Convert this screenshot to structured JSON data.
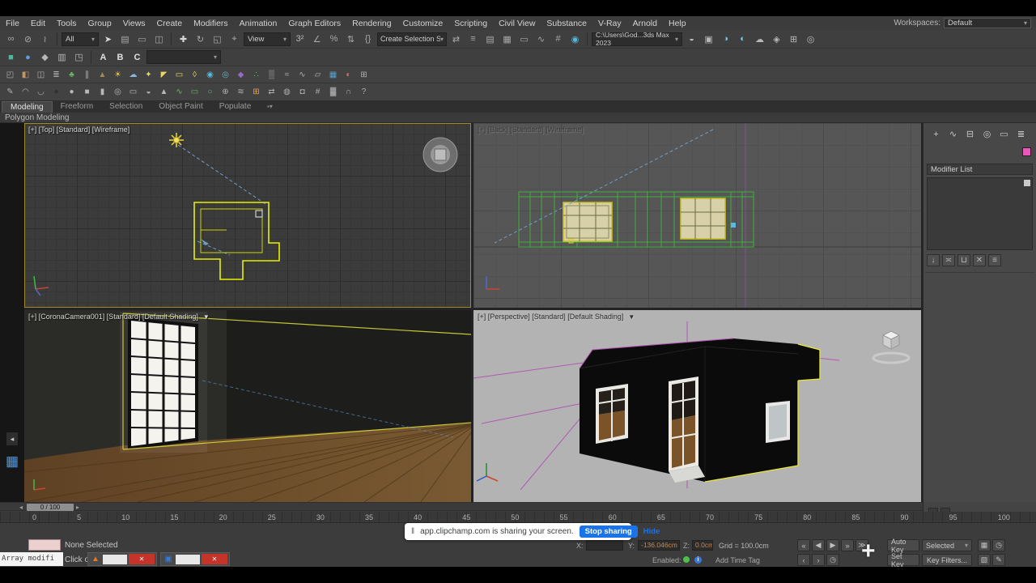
{
  "ui": {
    "caret": "▾",
    "funnel_icon": "▼",
    "close_icon": "✕",
    "plus_cursor": "+",
    "pause_bars": "‖",
    "info_i": "i",
    "slider_left_arrow": "◂",
    "slider_right_arrow": "▸"
  },
  "menu_bar": {
    "items": [
      "File",
      "Edit",
      "Tools",
      "Group",
      "Views",
      "Create",
      "Modifiers",
      "Animation",
      "Graph Editors",
      "Rendering",
      "Customize",
      "Scripting",
      "Civil View",
      "Substance",
      "V-Ray",
      "Arnold",
      "Help"
    ],
    "workspaces_label": "Workspaces:",
    "workspaces_value": "Default"
  },
  "toolbars": {
    "row1": {
      "seg_a": [
        {
          "n": "select-and-link-icon",
          "g": "∞",
          "c": "#a8a8a8"
        },
        {
          "n": "unlink-selection-icon",
          "g": "⊘",
          "c": "#a8a8a8"
        },
        {
          "n": "bind-to-space-warp-icon",
          "g": "≀",
          "c": "#a8a8a8"
        }
      ],
      "all_dropdown": "All",
      "seg_b": [
        {
          "n": "select-object-icon",
          "g": "➤",
          "c": "#d8d8d8"
        },
        {
          "n": "select-by-name-icon",
          "g": "▤",
          "c": "#a8a8a8"
        },
        {
          "n": "rectangular-selection-region-icon",
          "g": "▭",
          "c": "#a8a8a8"
        },
        {
          "n": "window-crossing-icon",
          "g": "◫",
          "c": "#a8a8a8"
        }
      ],
      "seg_c": [
        {
          "n": "select-and-move-icon",
          "g": "✚",
          "c": "#d8d8d8"
        },
        {
          "n": "select-and-rotate-icon",
          "g": "↻",
          "c": "#a8a8a8"
        },
        {
          "n": "select-and-scale-icon",
          "g": "◱",
          "c": "#a8a8a8"
        },
        {
          "n": "pivot-center-icon",
          "g": "⌖",
          "c": "#a8a8a8"
        }
      ],
      "view_dropdown": "View",
      "seg_d": [
        {
          "n": "snaps-toggle-icon",
          "g": "3²",
          "c": "#b8b8b8"
        },
        {
          "n": "angle-snap-icon",
          "g": "∠",
          "c": "#a8a8a8"
        },
        {
          "n": "percent-snap-icon",
          "g": "%",
          "c": "#a8a8a8"
        },
        {
          "n": "spinner-snap-icon",
          "g": "⇅",
          "c": "#a8a8a8"
        },
        {
          "n": "edit-named-selection-sets-icon",
          "g": "{}",
          "c": "#a8a8a8"
        }
      ],
      "selection_set_value": "Create Selection Se",
      "seg_e": [
        {
          "n": "mirror-icon",
          "g": "⇄",
          "c": "#a8a8a8"
        },
        {
          "n": "align-icon",
          "g": "≡",
          "c": "#a8a8a8"
        },
        {
          "n": "scene-explorer-icon",
          "g": "▤",
          "c": "#a8a8a8"
        },
        {
          "n": "layer-explorer-icon",
          "g": "▦",
          "c": "#a8a8a8"
        },
        {
          "n": "ribbon-toggle-icon",
          "g": "▭",
          "c": "#a8a8a8"
        },
        {
          "n": "curve-editor-icon",
          "g": "∿",
          "c": "#a8a8a8"
        },
        {
          "n": "schematic-view-icon",
          "g": "#",
          "c": "#a8a8a8"
        },
        {
          "n": "material-editor-icon",
          "g": "◉",
          "c": "#58b8d8"
        }
      ],
      "project_path": "C:\\Users\\God...3ds Max 2023",
      "seg_f": [
        {
          "n": "render-setup-icon",
          "g": "◒",
          "c": "#b8b8b8"
        },
        {
          "n": "rendered-frame-window-icon",
          "g": "▣",
          "c": "#b8b8b8"
        },
        {
          "n": "render-production-icon",
          "g": "◑",
          "c": "#78c8e8"
        },
        {
          "n": "render-iterative-icon",
          "g": "◐",
          "c": "#78c8e8"
        },
        {
          "n": "render-in-cloud-icon",
          "g": "☁",
          "c": "#b8b8b8"
        },
        {
          "n": "asset-library-icon",
          "g": "◈",
          "c": "#b8b8b8"
        },
        {
          "n": "data-channel-icon",
          "g": "⊞",
          "c": "#b8b8b8"
        },
        {
          "n": "arnold-light-icon",
          "g": "◎",
          "c": "#b8b8b8"
        }
      ]
    },
    "row2": {
      "icons_left": [
        {
          "n": "slate-material-editor-icon",
          "g": "■",
          "c": "#3fbf9f"
        },
        {
          "n": "compact-material-editor-icon",
          "g": "●",
          "c": "#5aa0e0"
        },
        {
          "n": "snapshot-icon",
          "g": "◆",
          "c": "#b8b8b8"
        },
        {
          "n": "layers-icon",
          "g": "▥",
          "c": "#b8b8b8"
        },
        {
          "n": "containers-icon",
          "g": "◳",
          "c": "#b8b8b8"
        }
      ],
      "letters": [
        {
          "n": "letter-a-icon",
          "g": "A",
          "c": "#e0e0e0"
        },
        {
          "n": "letter-b-icon",
          "g": "B",
          "c": "#e0e0e0"
        },
        {
          "n": "letter-c-icon",
          "g": "C",
          "c": "#e0e0e0"
        }
      ],
      "preset_dropdown_value": ""
    },
    "row3": {
      "icons": [
        {
          "n": "wall-tool-icon",
          "g": "◰",
          "c": "#b0b0b0"
        },
        {
          "n": "door-tool-icon",
          "g": "◧",
          "c": "#c09868"
        },
        {
          "n": "window-tool-icon",
          "g": "◫",
          "c": "#b0b0b0"
        },
        {
          "n": "stairs-tool-icon",
          "g": "≣",
          "c": "#b0b0b0"
        },
        {
          "n": "foliage-icon",
          "g": "♣",
          "c": "#68b868"
        },
        {
          "n": "railing-icon",
          "g": "∥",
          "c": "#b0b0b0"
        },
        {
          "n": "terrain-icon",
          "g": "▲",
          "c": "#a08858"
        },
        {
          "n": "sun-light-icon",
          "g": "☀",
          "c": "#e8c840"
        },
        {
          "n": "sky-light-icon",
          "g": "☁",
          "c": "#88b8e0"
        },
        {
          "n": "omni-light-icon",
          "g": "✦",
          "c": "#e8d860"
        },
        {
          "n": "spot-light-icon",
          "g": "◤",
          "c": "#e8d860"
        },
        {
          "n": "area-light-icon",
          "g": "▭",
          "c": "#e8d860"
        },
        {
          "n": "photometric-light-icon",
          "g": "◊",
          "c": "#e8d860"
        },
        {
          "n": "physical-camera-icon",
          "g": "◉",
          "c": "#58b8d8"
        },
        {
          "n": "target-camera-icon",
          "g": "◎",
          "c": "#58b8d8"
        },
        {
          "n": "proxy-object-icon",
          "g": "◆",
          "c": "#9868c8"
        },
        {
          "n": "scatter-tool-icon",
          "g": "∴",
          "c": "#68b868"
        },
        {
          "n": "volume-helper-icon",
          "g": "▒",
          "c": "#b0b0b0"
        },
        {
          "n": "displace-modifier-icon",
          "g": "≈",
          "c": "#b0b0b0"
        },
        {
          "n": "hair-fur-icon",
          "g": "∿",
          "c": "#b0b0b0"
        },
        {
          "n": "cloth-modifier-icon",
          "g": "▱",
          "c": "#b0b0b0"
        },
        {
          "n": "bitmap-map-icon",
          "g": "▦",
          "c": "#58a0d0"
        },
        {
          "n": "color-correction-icon",
          "g": "◐",
          "c": "#d87858"
        },
        {
          "n": "uvw-map-icon",
          "g": "⊞",
          "c": "#b0b0b0"
        }
      ]
    },
    "row4": {
      "icons": [
        {
          "n": "paint-deform-icon",
          "g": "✎",
          "c": "#b0b0b0"
        },
        {
          "n": "conform-brush-icon",
          "g": "◠",
          "c": "#b0b0b0"
        },
        {
          "n": "relax-brush-icon",
          "g": "◡",
          "c": "#b0b0b0"
        },
        {
          "n": "pool-ball-icon",
          "g": "●",
          "c": "#303030"
        },
        {
          "n": "sphere-primitive-icon",
          "g": "●",
          "c": "#b8b8b8"
        },
        {
          "n": "box-primitive-icon",
          "g": "■",
          "c": "#b8b8b8"
        },
        {
          "n": "cylinder-primitive-icon",
          "g": "▮",
          "c": "#b8b8b8"
        },
        {
          "n": "torus-primitive-icon",
          "g": "◎",
          "c": "#b8b8b8"
        },
        {
          "n": "plane-primitive-icon",
          "g": "▭",
          "c": "#b8b8b8"
        },
        {
          "n": "teapot-primitive-icon",
          "g": "◒",
          "c": "#b8b8b8"
        },
        {
          "n": "cone-primitive-icon",
          "g": "▲",
          "c": "#b8b8b8"
        },
        {
          "n": "spline-tool-icon",
          "g": "∿",
          "c": "#68b868"
        },
        {
          "n": "rectangle-spline-icon",
          "g": "▭",
          "c": "#68b868"
        },
        {
          "n": "circle-spline-icon",
          "g": "○",
          "c": "#68b868"
        },
        {
          "n": "boolean-tool-icon",
          "g": "⊕",
          "c": "#b0b0b0"
        },
        {
          "n": "loft-tool-icon",
          "g": "≋",
          "c": "#b0b0b0"
        },
        {
          "n": "ffd-modifier-icon",
          "g": "⊞",
          "c": "#e8a048"
        },
        {
          "n": "symmetry-modifier-icon",
          "g": "⇄",
          "c": "#b0b0b0"
        },
        {
          "n": "turbosmooth-icon",
          "g": "◍",
          "c": "#b0b0b0"
        },
        {
          "n": "shell-modifier-icon",
          "g": "◘",
          "c": "#b0b0b0"
        },
        {
          "n": "lattice-modifier-icon",
          "g": "#",
          "c": "#b0b0b0"
        },
        {
          "n": "noise-modifier-icon",
          "g": "▓",
          "c": "#b0b0b0"
        },
        {
          "n": "bend-modifier-icon",
          "g": "∩",
          "c": "#b0b0b0"
        },
        {
          "n": "help-icon",
          "g": "?",
          "c": "#b0b0b0"
        }
      ]
    }
  },
  "ribbon": {
    "tabs": [
      "Modeling",
      "Freeform",
      "Selection",
      "Object Paint",
      "Populate"
    ],
    "active_tab": "Modeling",
    "panel_label": "Polygon Modeling"
  },
  "left_strip": {
    "icons": [
      {
        "n": "collapse-panel-icon",
        "g": "◂",
        "c": "#c8c8c8"
      },
      {
        "n": "massfx-toolbar-icon",
        "g": "▦",
        "c": "#5898d8"
      }
    ]
  },
  "viewports": {
    "top_left": {
      "label": "[+] [Top] [Standard] [Wireframe]"
    },
    "top_right": {
      "label": "[+] [Back] [Standard] [Wireframe]"
    },
    "bottom_left": {
      "label": "[+] [CoronaCamera001] [Standard] [Default Shading]"
    },
    "bottom_right": {
      "label": "[+] [Perspective] [Standard] [Default Shading]"
    }
  },
  "command_panel": {
    "tab_icons": [
      {
        "n": "create-tab-icon",
        "g": "+",
        "c": "#c8c8c8"
      },
      {
        "n": "modify-tab-icon",
        "g": "∿",
        "c": "#c8c8c8"
      },
      {
        "n": "hierarchy-tab-icon",
        "g": "⊟",
        "c": "#c8c8c8"
      },
      {
        "n": "motion-tab-icon",
        "g": "◎",
        "c": "#c8c8c8"
      },
      {
        "n": "display-tab-icon",
        "g": "▭",
        "c": "#c8c8c8"
      },
      {
        "n": "utilities-tab-icon",
        "g": "≣",
        "c": "#c8c8c8"
      }
    ],
    "modifier_list_label": "Modifier List",
    "stack_buttons": [
      {
        "n": "pin-stack-icon",
        "g": "↓",
        "c": "#b8b8b8"
      },
      {
        "n": "show-end-result-icon",
        "g": "≍",
        "c": "#b8b8b8"
      },
      {
        "n": "make-unique-icon",
        "g": "⊔",
        "c": "#b8b8b8"
      },
      {
        "n": "remove-modifier-icon",
        "g": "✕",
        "c": "#b8b8b8"
      },
      {
        "n": "configure-modifier-sets-icon",
        "g": "≡",
        "c": "#b8b8b8"
      }
    ]
  },
  "timeline": {
    "slider_label": "0 / 100",
    "ticks": [
      "0",
      "5",
      "10",
      "15",
      "20",
      "25",
      "30",
      "35",
      "40",
      "45",
      "50",
      "55",
      "60",
      "65",
      "70",
      "75",
      "80",
      "85",
      "90",
      "95",
      "100"
    ]
  },
  "transport": {
    "row1": [
      {
        "n": "go-to-start-button",
        "g": "«"
      },
      {
        "n": "previous-frame-button",
        "g": "◀"
      },
      {
        "n": "play-button",
        "g": "▶"
      },
      {
        "n": "next-frame-button",
        "g": "»"
      },
      {
        "n": "go-to-end-button",
        "g": "≫"
      }
    ],
    "row2": [
      {
        "n": "previous-key-button",
        "g": "‹"
      },
      {
        "n": "next-key-button",
        "g": "›"
      },
      {
        "n": "time-configuration-button",
        "g": "◷"
      }
    ],
    "right_icons_row1": [
      {
        "n": "selection-lock-button",
        "g": "▦"
      },
      {
        "n": "time-display-button",
        "g": "◷"
      }
    ],
    "right_icons_row2": [
      {
        "n": "grid-toggle-button",
        "g": "▧"
      },
      {
        "n": "annotate-button",
        "g": "✎"
      }
    ]
  },
  "share_banner": {
    "message": "app.clipchamp.com is sharing your screen.",
    "stop_button": "Stop sharing",
    "hide_link": "Hide"
  },
  "status_bar": {
    "selection_status": "None Selected",
    "prompt_line": "Click or click",
    "listener_text": "Array modifi",
    "x_label": "X:",
    "x_value": "",
    "y_label": "Y:",
    "y_value": "-136.046cm",
    "z_label": "Z:",
    "z_value": "0.0cm",
    "grid_label": "Grid = 100.0cm",
    "enabled_label": "Enabled:",
    "add_time_tag": "Add Time Tag",
    "auto_key": "Auto Key",
    "selected_dropdown": "Selected",
    "set_key": "Set Key",
    "key_filters": "Key Filters..."
  },
  "mini_windows": [
    {
      "n": "app-icon-orange",
      "icon_g": "▲",
      "icon_c": "#e87820"
    },
    {
      "n": "app-icon-blue",
      "icon_g": "▣",
      "icon_c": "#3878d8"
    }
  ]
}
